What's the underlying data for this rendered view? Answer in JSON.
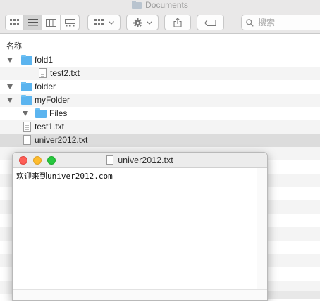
{
  "window": {
    "title": "Documents"
  },
  "toolbar": {
    "views": [
      "icon-view-icon",
      "list-view-icon",
      "column-view-icon",
      "gallery-view-icon"
    ],
    "active_view": 1,
    "search": {
      "placeholder": "搜索",
      "value": ""
    }
  },
  "columns": {
    "name_header": "名称"
  },
  "files": [
    {
      "name": "fold1",
      "kind": "folder",
      "expanded": true,
      "depth": 0
    },
    {
      "name": "test2.txt",
      "kind": "file",
      "depth": 1
    },
    {
      "name": "folder",
      "kind": "folder",
      "expanded": true,
      "depth": 0
    },
    {
      "name": "myFolder",
      "kind": "folder",
      "expanded": true,
      "depth": 0
    },
    {
      "name": "Files",
      "kind": "folder",
      "expanded": true,
      "depth": 1
    },
    {
      "name": "test1.txt",
      "kind": "file",
      "depth": 0
    },
    {
      "name": "univer2012.txt",
      "kind": "file",
      "depth": 0,
      "selected": true
    }
  ],
  "editor": {
    "title": "univer2012.txt",
    "content": "欢迎来到univer2012.com"
  },
  "colors": {
    "folder": "#5bb4ef",
    "selection": "#dcdcdc",
    "stripe": "#f4f4f4",
    "close": "#fe5f57",
    "minimize": "#febc2e",
    "zoom": "#28c840"
  }
}
